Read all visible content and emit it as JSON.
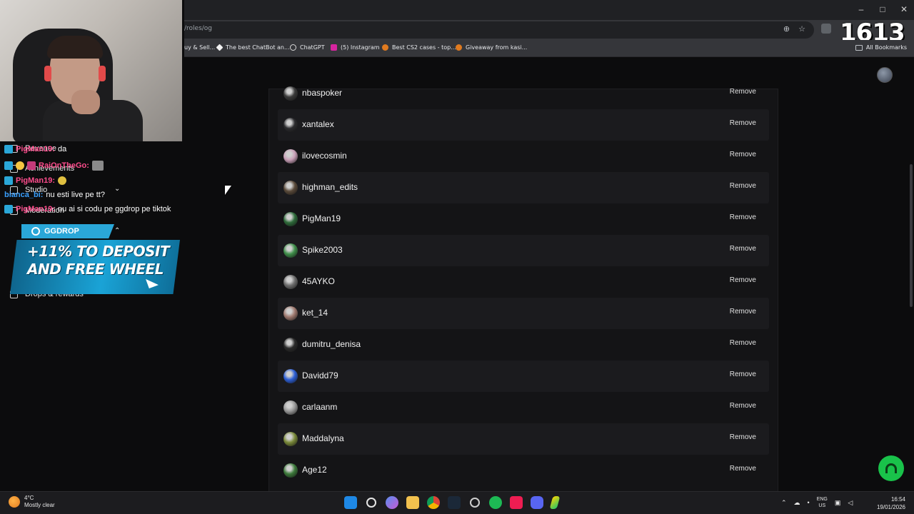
{
  "browser": {
    "url": "/roles/og",
    "counter": "1613",
    "bookmarks": [
      {
        "label": "uy & Sell...",
        "color": "#888888"
      },
      {
        "label": "The best ChatBot an...",
        "color": "#f2f2f2"
      },
      {
        "label": "ChatGPT",
        "color": "#d9d9d9"
      },
      {
        "label": "(5) Instagram",
        "color": "#d6249f"
      },
      {
        "label": "Best CS2 cases - top...",
        "color": "#e07a1f"
      },
      {
        "label": "Giveaway from kasi...",
        "color": "#e07a1f"
      }
    ],
    "all_bookmarks": "All Bookmarks",
    "window_controls": {
      "minimize": "–",
      "maximize": "□",
      "close": "✕"
    }
  },
  "members": {
    "remove_label": "Remove",
    "rows": [
      {
        "name": "nbaspoker",
        "avatar_color": "#3a3a3a"
      },
      {
        "name": "xantalex",
        "avatar_color": "#2b2b2e"
      },
      {
        "name": "ilovecosmin",
        "avatar_color": "#c9a0b8"
      },
      {
        "name": "highman_edits",
        "avatar_color": "#5a4a3a"
      },
      {
        "name": "PigMan19",
        "avatar_color": "#2e6b3a"
      },
      {
        "name": "Spike2003",
        "avatar_color": "#3f8f4a"
      },
      {
        "name": "45AYKO",
        "avatar_color": "#6e6e6e"
      },
      {
        "name": "ket_14",
        "avatar_color": "#a07a70"
      },
      {
        "name": "dumitru_denisa",
        "avatar_color": "#2a2a2a"
      },
      {
        "name": "Davidd79",
        "avatar_color": "#2d5fd6"
      },
      {
        "name": "carlaanm",
        "avatar_color": "#9a9a9a"
      },
      {
        "name": "Maddalyna",
        "avatar_color": "#7a8a3a"
      },
      {
        "name": "Age12",
        "avatar_color": "#3c7a3a"
      }
    ]
  },
  "stream_overlay": {
    "chat": [
      {
        "user": "PigMan19:",
        "message": "da",
        "user_color": "#ff4d8d"
      },
      {
        "user": "RaiOnTheGo:",
        "message": "",
        "user_color": "#ff4d8d"
      },
      {
        "user": "PigMan19:",
        "message": "",
        "user_color": "#ff4d8d"
      },
      {
        "user": "bianca_bi:",
        "message": "nu esti live pe tt?",
        "user_color": "#3aa0ff"
      },
      {
        "user": "PigMan19:",
        "message": "nu ai si codu pe ggdrop pe tiktok",
        "user_color": "#ff4d8d"
      }
    ],
    "sidebar": {
      "revenue": "Revenue",
      "achievements": "Achievements",
      "studio": "Studio",
      "moderation": "Moderation",
      "drops": "Drops & rewards"
    },
    "promo": {
      "brand": "GGDROP",
      "text": "+11% TO DEPOSIT AND FREE WHEEL"
    }
  },
  "taskbar": {
    "temperature": "4°C",
    "weather": "Mostly clear",
    "lang": "ENG",
    "region": "US",
    "time": "16:54",
    "date": "19/01/2026"
  },
  "colors": {
    "accent_green": "#19c24a",
    "panel_bg": "#141416",
    "row_alt": "#1b1b1e"
  }
}
